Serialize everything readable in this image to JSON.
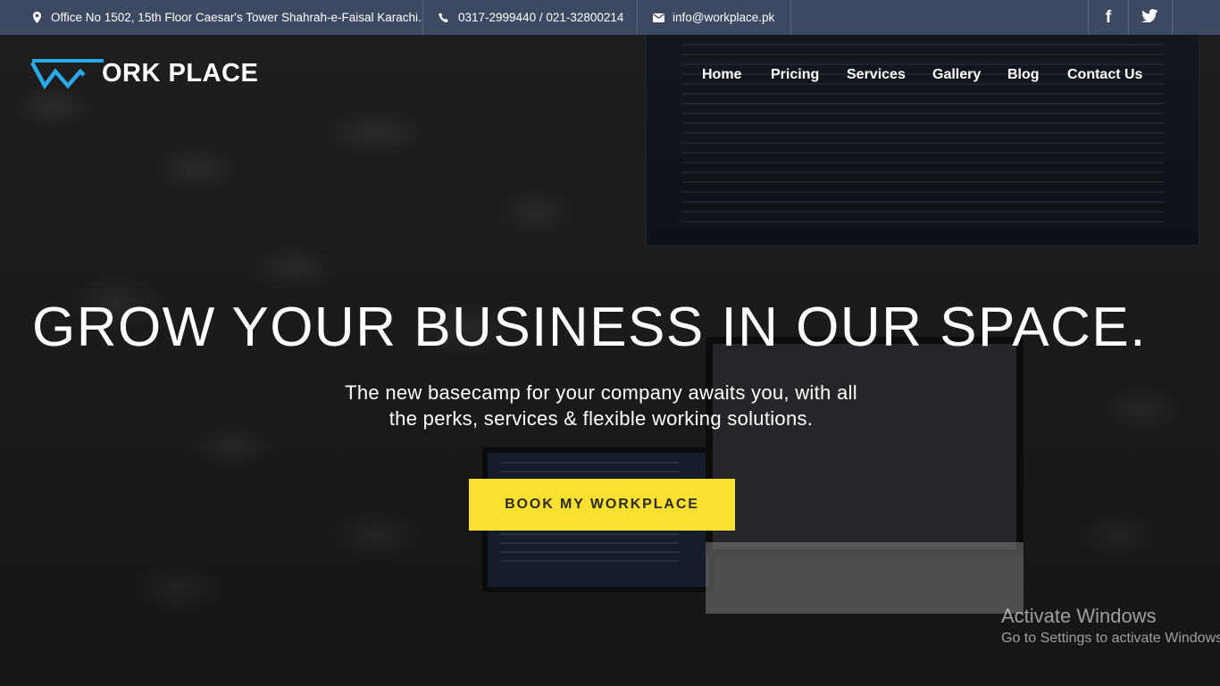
{
  "topbar": {
    "address": "Office No 1502, 15th Floor Caesar's Tower Shahrah-e-Faisal Karachi.",
    "phone": "0317-2999440 / 021-32800214",
    "email": "info@workplace.pk",
    "background": "#3b4a61",
    "social": [
      {
        "name": "facebook-icon",
        "glyph": "f"
      },
      {
        "name": "twitter-icon",
        "glyph": "🐦"
      }
    ]
  },
  "brand": {
    "logo_text": "ORK PLACE",
    "accent": "#2aa8e8"
  },
  "nav": {
    "items": [
      "Home",
      "Pricing",
      "Services",
      "Gallery",
      "Blog",
      "Contact Us"
    ]
  },
  "hero": {
    "headline": "GROW YOUR BUSINESS IN OUR SPACE.",
    "subtext_line1": "The new basecamp for your company awaits you, with all",
    "subtext_line2": "the perks, services & flexible working solutions.",
    "cta_label": "BOOK MY WORKPLACE",
    "cta_color": "#fde130"
  },
  "watermark": {
    "title": "Activate Windows",
    "subtitle": "Go to Settings to activate Windows."
  }
}
